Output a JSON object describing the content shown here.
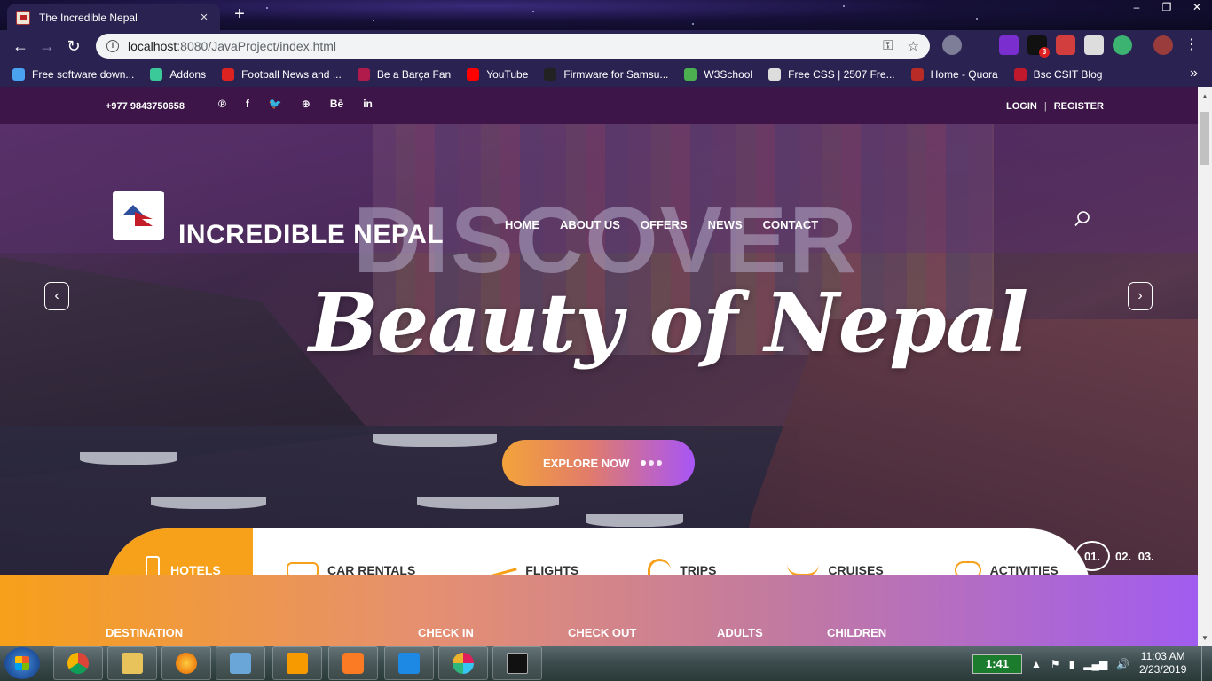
{
  "browser": {
    "tab_title": "The Incredible Nepal",
    "tab_close": "×",
    "new_tab": "+",
    "window_controls": [
      "‒",
      "❐",
      "✕"
    ],
    "nav": {
      "back": "←",
      "forward": "→",
      "reload": "↻"
    },
    "url_host": "localhost",
    "url_rest": ":8080/JavaProject/index.html",
    "info_icon": "i",
    "key_icon": "⚿",
    "star_icon": "☆",
    "extensions_badge": "3",
    "bookmarks": [
      {
        "label": "Free software down...",
        "color": "#4aa3f0"
      },
      {
        "label": "Addons",
        "color": "#3cc99a"
      },
      {
        "label": "Football News and ...",
        "color": "#d22"
      },
      {
        "label": "Be a Barça Fan",
        "color": "#b01b4c"
      },
      {
        "label": "YouTube",
        "color": "#f00"
      },
      {
        "label": "Firmware for Samsu...",
        "color": "#222"
      },
      {
        "label": "W3School",
        "color": "#4caf50"
      },
      {
        "label": "Free CSS | 2507 Fre...",
        "color": "#ddd"
      },
      {
        "label": "Home - Quora",
        "color": "#b92b27"
      },
      {
        "label": "Bsc CSIT Blog",
        "color": "#c0182c"
      }
    ],
    "bookmarks_more": "»"
  },
  "page": {
    "phone": "+977 9843750658",
    "socials": [
      "℗",
      "f",
      "🐦",
      "⊕",
      "Bē",
      "in"
    ],
    "login": "LOGIN",
    "separator": "|",
    "register": "REGISTER",
    "site_name": "INCREDIBLE NEPAL",
    "watermark": "DISCOVER",
    "nav": [
      "HOME",
      "ABOUT US",
      "OFFERS",
      "NEWS",
      "CONTACT"
    ],
    "headline": "Beauty of Nepal",
    "prev_arrow": "‹",
    "next_arrow": "›",
    "explore_button": "EXPLORE NOW",
    "services": [
      {
        "label": "HOTELS",
        "icon": "luggage-icon",
        "active": true
      },
      {
        "label": "CAR RENTALS",
        "icon": "bus-icon"
      },
      {
        "label": "FLIGHTS",
        "icon": "plane-icon"
      },
      {
        "label": "TRIPS",
        "icon": "palm-tree-icon"
      },
      {
        "label": "CRUISES",
        "icon": "ship-icon"
      },
      {
        "label": "ACTIVITIES",
        "icon": "snorkel-icon"
      }
    ],
    "slides": {
      "current": "01.",
      "others": [
        "02.",
        "03."
      ]
    },
    "search_fields": [
      "DESTINATION",
      "CHECK IN",
      "CHECK OUT",
      "ADULTS",
      "CHILDREN"
    ]
  },
  "taskbar": {
    "battery_time": "1:41",
    "tray_icons": [
      "▲",
      "⚑",
      "▮",
      "▂▄▆",
      "🔊"
    ],
    "time": "11:03 AM",
    "date": "2/23/2019",
    "apps": [
      {
        "name": "chrome",
        "color": "#e0412f"
      },
      {
        "name": "file-explorer",
        "color": "#e8c25a"
      },
      {
        "name": "firefox",
        "color": "#e66000"
      },
      {
        "name": "virtualbox",
        "color": "#6aa6d8"
      },
      {
        "name": "sublime-text",
        "color": "#f79a00"
      },
      {
        "name": "xampp",
        "color": "#fb7a24"
      },
      {
        "name": "vs-code",
        "color": "#1e88e5"
      },
      {
        "name": "slack",
        "color": "#6ecadc"
      },
      {
        "name": "command-prompt",
        "color": "#111"
      }
    ]
  }
}
